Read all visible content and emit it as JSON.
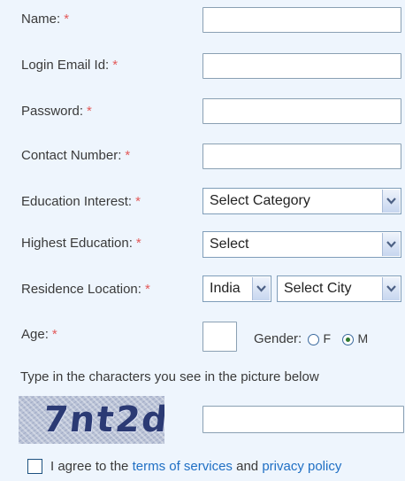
{
  "form": {
    "required_marker": "*",
    "name": {
      "label": "Name:",
      "value": ""
    },
    "email": {
      "label": "Login Email Id:",
      "value": ""
    },
    "password": {
      "label": "Password:",
      "value": ""
    },
    "contact": {
      "label": "Contact Number:",
      "value": ""
    },
    "education_interest": {
      "label": "Education Interest:",
      "selected": "Select Category"
    },
    "highest_education": {
      "label": "Highest Education:",
      "selected": "Select"
    },
    "residence": {
      "label": "Residence Location:",
      "country_selected": "India",
      "city_selected": "Select City"
    },
    "age": {
      "label": "Age:",
      "value": ""
    },
    "gender": {
      "label": "Gender:",
      "option_f": "F",
      "option_m": "M",
      "selected": "M"
    },
    "captcha": {
      "instruction": "Type in the characters you see in the picture below",
      "image_text": "7nt2d",
      "value": ""
    },
    "agree": {
      "prefix": "I agree to the ",
      "terms_link": "terms of services",
      "and": " and ",
      "privacy_link": "privacy policy",
      "checked": false
    }
  },
  "colors": {
    "background": "#eef5fd",
    "required": "#e35a5a",
    "link": "#1f6fc4"
  }
}
